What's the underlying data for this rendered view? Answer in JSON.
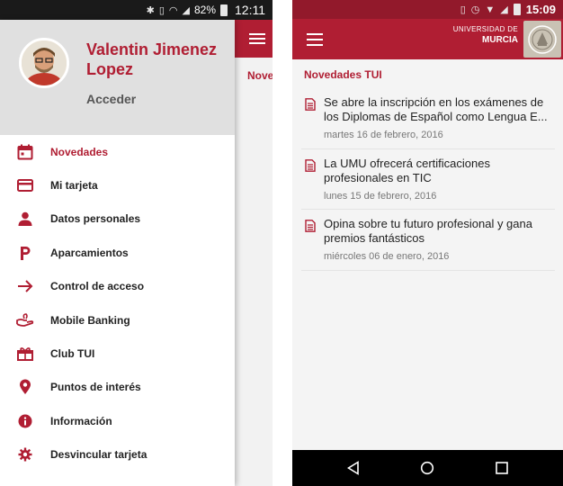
{
  "left_phone": {
    "status_bar": {
      "battery": "82%",
      "time": "12:11",
      "icons": [
        "bluetooth-icon",
        "vibrate-icon",
        "wifi-icon",
        "signal-icon",
        "battery-icon"
      ]
    },
    "background_app": {
      "menu_icon": "hamburger-icon",
      "section_label_partial": "Novedades TUI"
    },
    "drawer": {
      "user_name": "Valentin Jimenez Lopez",
      "login_label": "Acceder",
      "items": [
        {
          "label": "Novedades",
          "icon": "calendar-icon",
          "active": true
        },
        {
          "label": "Mi tarjeta",
          "icon": "credit-card-icon",
          "active": false
        },
        {
          "label": "Datos personales",
          "icon": "person-icon",
          "active": false
        },
        {
          "label": "Aparcamientos",
          "icon": "parking-icon",
          "active": false
        },
        {
          "label": "Control de acceso",
          "icon": "arrow-right-icon",
          "active": false
        },
        {
          "label": "Mobile Banking",
          "icon": "hand-coin-icon",
          "active": false
        },
        {
          "label": "Club TUI",
          "icon": "gift-icon",
          "active": false
        },
        {
          "label": "Puntos de interés",
          "icon": "map-pin-icon",
          "active": false
        },
        {
          "label": "Información",
          "icon": "info-icon",
          "active": false
        },
        {
          "label": "Desvincular tarjeta",
          "icon": "gear-icon",
          "active": false
        }
      ]
    }
  },
  "right_phone": {
    "status_bar": {
      "time": "15:09",
      "icons": [
        "vibrate-icon",
        "alarm-icon",
        "wifi-icon",
        "signal-icon",
        "battery-icon"
      ]
    },
    "app_bar": {
      "menu_icon": "hamburger-icon",
      "logo_line1": "UNIVERSIDAD DE",
      "logo_line2": "MURCIA",
      "crest_icon": "university-crest-icon"
    },
    "section_title": "Novedades TUI",
    "news": [
      {
        "title": "Se abre la inscripción en los exámenes de los Diplomas de Español como Lengua E...",
        "date": "martes 16 de febrero, 2016",
        "icon": "document-icon"
      },
      {
        "title": "La UMU ofrecerá certificaciones profesionales en TIC",
        "date": "lunes 15 de febrero, 2016",
        "icon": "document-icon"
      },
      {
        "title": "Opina sobre tu futuro profesional y gana premios fantásticos",
        "date": "miércoles 06 de enero, 2016",
        "icon": "document-icon"
      }
    ],
    "nav_bar": [
      "back-icon",
      "home-icon",
      "recents-icon"
    ]
  },
  "colors": {
    "brand_red": "#b01e33",
    "status_bar_red": "#92192b",
    "drawer_header": "#e0e0e0",
    "content_bg": "#f4f4f4"
  }
}
